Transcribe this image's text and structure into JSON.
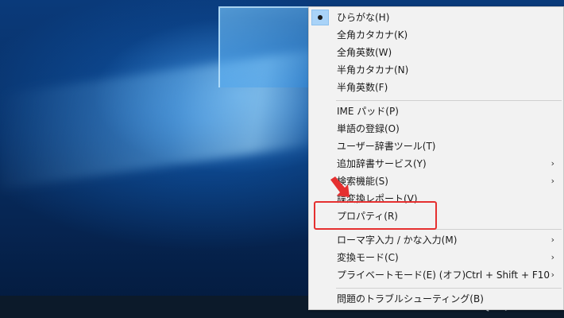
{
  "menu": {
    "items": [
      {
        "label": "ひらがな(H)",
        "checked": true
      },
      {
        "label": "全角カタカナ(K)"
      },
      {
        "label": "全角英数(W)"
      },
      {
        "label": "半角カタカナ(N)"
      },
      {
        "label": "半角英数(F)"
      },
      {
        "label": "IME パッド(P)"
      },
      {
        "label": "単語の登録(O)"
      },
      {
        "label": "ユーザー辞書ツール(T)"
      },
      {
        "label": "追加辞書サービス(Y)",
        "submenu": "›"
      },
      {
        "label": "検索機能(S)",
        "submenu": "›"
      },
      {
        "label": "誤変換レポート(V)"
      },
      {
        "label": "プロパティ(R)"
      },
      {
        "label": "ローマ字入力 / かな入力(M)",
        "submenu": "›"
      },
      {
        "label": "変換モード(C)",
        "submenu": "›"
      },
      {
        "label": "プライベートモード(E) (オフ)",
        "shortcut": "Ctrl + Shift + F10",
        "submenu": "›"
      },
      {
        "label": "問題のトラブルシューティング(B)"
      }
    ]
  },
  "taskbar": {
    "clock": "20:18"
  },
  "colors": {
    "highlight_border": "#e53030",
    "arrow": "#e53030",
    "checked_bg": "#a9d3f8"
  },
  "icons": {
    "check": "radio-dot-icon",
    "submenu": "chevron-right-icon",
    "annotation": "red-arrow-icon"
  }
}
